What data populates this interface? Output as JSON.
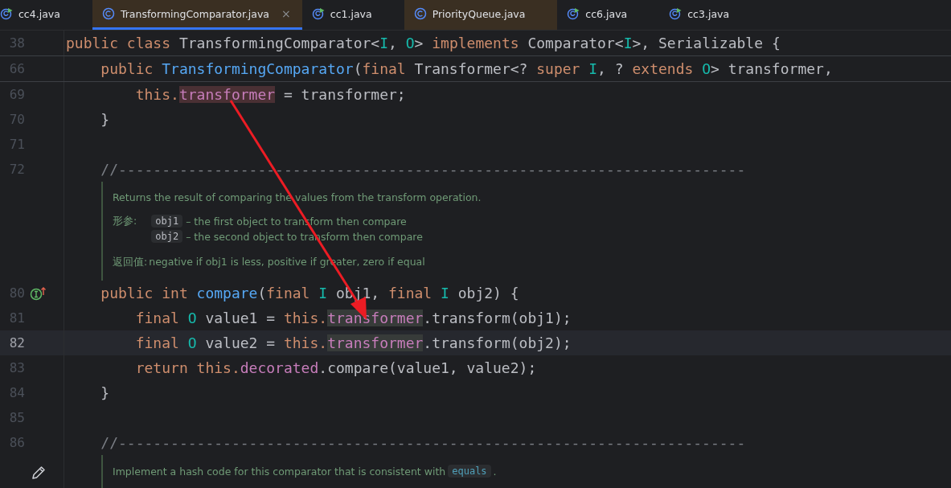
{
  "tabs": [
    {
      "label": "cc4.java",
      "kind": "runnable",
      "selected": false
    },
    {
      "label": "TransformingComparator.java",
      "kind": "library",
      "selected": true,
      "close": "×"
    },
    {
      "label": "cc1.java",
      "kind": "runnable",
      "selected": false
    },
    {
      "label": "PriorityQueue.java",
      "kind": "library",
      "selected": false
    },
    {
      "label": "cc6.java",
      "kind": "runnable",
      "selected": false
    },
    {
      "label": "cc3.java",
      "kind": "runnable",
      "selected": false
    }
  ],
  "sticky_lines": [
    {
      "number": "38",
      "tokens": [
        {
          "kind": "kw",
          "text": "public class "
        },
        {
          "kind": "plain",
          "text": "TransformingComparator<"
        },
        {
          "kind": "param",
          "text": "I"
        },
        {
          "kind": "plain",
          "text": ", "
        },
        {
          "kind": "param",
          "text": "O"
        },
        {
          "kind": "plain",
          "text": "> "
        },
        {
          "kind": "kw",
          "text": "implements "
        },
        {
          "kind": "plain",
          "text": "Comparator<"
        },
        {
          "kind": "param",
          "text": "I"
        },
        {
          "kind": "plain",
          "text": ">, Serializable {"
        }
      ]
    },
    {
      "number": "66",
      "tokens": [
        {
          "kind": "kw",
          "text": "    public "
        },
        {
          "kind": "fn",
          "text": "TransformingComparator"
        },
        {
          "kind": "plain",
          "text": "("
        },
        {
          "kind": "kw",
          "text": "final "
        },
        {
          "kind": "plain",
          "text": "Transformer<? "
        },
        {
          "kind": "kw",
          "text": "super "
        },
        {
          "kind": "param",
          "text": "I"
        },
        {
          "kind": "plain",
          "text": ", ? "
        },
        {
          "kind": "kw",
          "text": "extends "
        },
        {
          "kind": "param",
          "text": "O"
        },
        {
          "kind": "plain",
          "text": "> transformer,"
        }
      ]
    }
  ],
  "lines": [
    {
      "kind": "code",
      "number": "69",
      "current": false,
      "tokens": [
        {
          "kind": "kw",
          "text": "        this."
        },
        {
          "kind": "field",
          "text": "transformer",
          "highlighted": true,
          "write": true
        },
        {
          "kind": "plain",
          "text": " = transformer;"
        }
      ]
    },
    {
      "kind": "code",
      "number": "70",
      "current": false,
      "tokens": [
        {
          "kind": "plain",
          "text": "    }"
        }
      ]
    },
    {
      "kind": "code",
      "number": "71",
      "current": false
    },
    {
      "kind": "code",
      "number": "72",
      "current": false,
      "tokens": [
        {
          "kind": "comment",
          "text": "    //------------------------------------------------------------------------"
        }
      ]
    },
    {
      "kind": "doc",
      "description": "Returns the result of comparing the values from the transform operation.",
      "params_label": "形参:",
      "params": [
        {
          "name": "obj1",
          "text": "– the first object to transform then compare"
        },
        {
          "name": "obj2",
          "text": "– the second object to transform then compare"
        }
      ],
      "returns_label": "返回值:",
      "returns": "negative if obj1 is less, positive if greater, zero if equal"
    },
    {
      "kind": "code",
      "number": "80",
      "current": false,
      "implements_marker": true,
      "tokens": [
        {
          "kind": "kw",
          "text": "    public int "
        },
        {
          "kind": "fn",
          "text": "compare"
        },
        {
          "kind": "plain",
          "text": "("
        },
        {
          "kind": "kw",
          "text": "final "
        },
        {
          "kind": "param",
          "text": "I"
        },
        {
          "kind": "plain",
          "text": " obj1, "
        },
        {
          "kind": "kw",
          "text": "final "
        },
        {
          "kind": "param",
          "text": "I"
        },
        {
          "kind": "plain",
          "text": " obj2) {"
        }
      ]
    },
    {
      "kind": "code",
      "number": "81",
      "current": false,
      "tokens": [
        {
          "kind": "kw",
          "text": "        final "
        },
        {
          "kind": "param",
          "text": "O"
        },
        {
          "kind": "plain",
          "text": " value1 = "
        },
        {
          "kind": "kw",
          "text": "this."
        },
        {
          "kind": "field",
          "text": "transformer",
          "highlighted": true,
          "write": false
        },
        {
          "kind": "plain",
          "text": ".transform(obj1);"
        }
      ]
    },
    {
      "kind": "code",
      "number": "82",
      "current": true,
      "tokens": [
        {
          "kind": "kw",
          "text": "        final "
        },
        {
          "kind": "param",
          "text": "O"
        },
        {
          "kind": "plain",
          "text": " value2 = "
        },
        {
          "kind": "kw",
          "text": "this."
        },
        {
          "kind": "field",
          "text": "transformer",
          "highlighted": true,
          "write": false
        },
        {
          "kind": "plain",
          "text": ".transform(obj2);"
        }
      ]
    },
    {
      "kind": "code",
      "number": "83",
      "current": false,
      "tokens": [
        {
          "kind": "kw",
          "text": "        return this."
        },
        {
          "kind": "field",
          "text": "decorated"
        },
        {
          "kind": "plain",
          "text": ".compare(value1, value2);"
        }
      ]
    },
    {
      "kind": "code",
      "number": "84",
      "current": false,
      "tokens": [
        {
          "kind": "plain",
          "text": "    }"
        }
      ]
    },
    {
      "kind": "code",
      "number": "85",
      "current": false
    },
    {
      "kind": "code",
      "number": "86",
      "current": false,
      "tokens": [
        {
          "kind": "comment",
          "text": "    //------------------------------------------------------------------------"
        }
      ]
    },
    {
      "kind": "doc",
      "description": "Implement a hash code for this comparator that is consistent with",
      "code_ref": "equals",
      "suffix": "."
    }
  ]
}
